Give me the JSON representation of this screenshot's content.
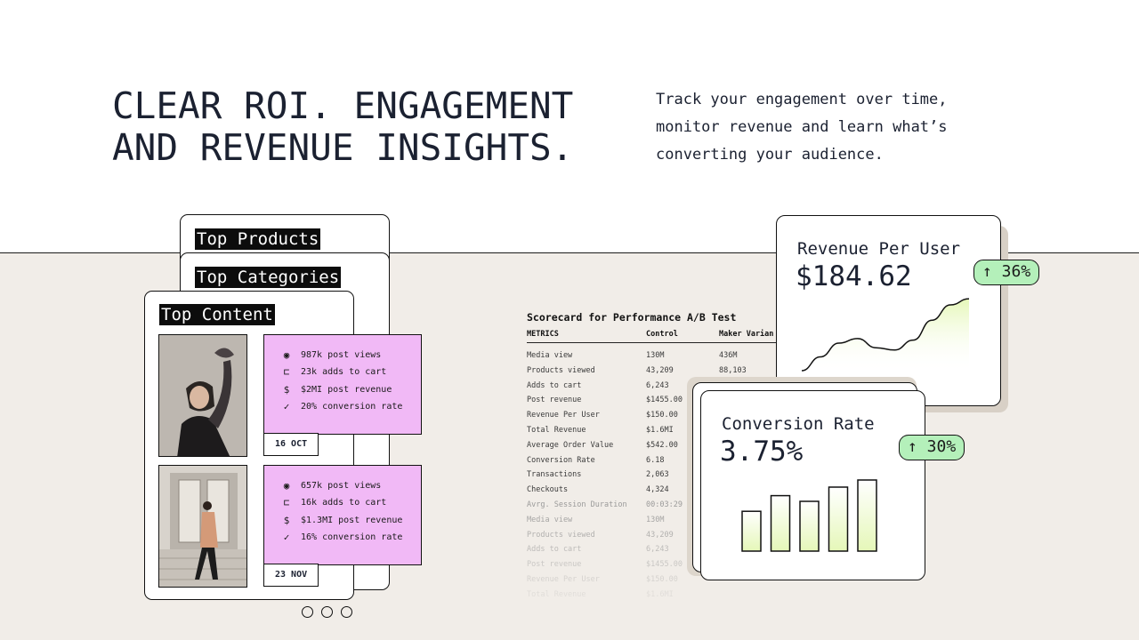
{
  "hero": {
    "headline": [
      "CLEAR ROI. ENGAGEMENT",
      "AND REVENUE INSIGHTS."
    ],
    "subtext": [
      "Track your engagement over time,",
      "monitor revenue and learn what’s",
      "converting your audience."
    ]
  },
  "cards": {
    "top_products": "Top Products",
    "top_categories": "Top Categories",
    "top_content": "Top Content"
  },
  "posts": [
    {
      "stats": [
        {
          "icon": "eye-icon",
          "text": "987k post views"
        },
        {
          "icon": "cart-icon",
          "text": "23k adds to cart"
        },
        {
          "icon": "dollar-icon",
          "text": "$2MI post revenue"
        },
        {
          "icon": "check-icon",
          "text": "20% conversion rate"
        }
      ],
      "date": "16 OCT"
    },
    {
      "stats": [
        {
          "icon": "eye-icon",
          "text": "657k post views"
        },
        {
          "icon": "cart-icon",
          "text": "16k adds to cart"
        },
        {
          "icon": "dollar-icon",
          "text": "$1.3MI post revenue"
        },
        {
          "icon": "check-icon",
          "text": "16% conversion rate"
        }
      ],
      "date": "23 NOV"
    }
  ],
  "scorecard": {
    "title": "Scorecard for Performance A/B Test",
    "headers": [
      "METRICS",
      "Control",
      "Maker Varian"
    ],
    "rows": [
      [
        "Media view",
        "130M",
        "436M"
      ],
      [
        "Products viewed",
        "43,209",
        "88,103"
      ],
      [
        "Adds to cart",
        "6,243",
        ""
      ],
      [
        "Post revenue",
        "$1455.00",
        ""
      ],
      [
        "Revenue Per User",
        "$150.00",
        ""
      ],
      [
        "Total Revenue",
        "$1.6MI",
        ""
      ],
      [
        "Average Order Value",
        "$542.00",
        ""
      ],
      [
        "Conversion Rate",
        "6.18",
        ""
      ],
      [
        "Transactions",
        "2,063",
        ""
      ],
      [
        "Checkouts",
        "4,324",
        ""
      ],
      [
        "Avrg. Session Duration",
        "00:03:29",
        ""
      ],
      [
        "Media view",
        "130M",
        ""
      ],
      [
        "Products viewed",
        "43,209",
        ""
      ],
      [
        "Adds to cart",
        "6,243",
        ""
      ],
      [
        "Post revenue",
        "$1455.00",
        ""
      ],
      [
        "Revenue Per User",
        "$150.00",
        ""
      ],
      [
        "Total Revenue",
        "$1.6MI",
        ""
      ]
    ]
  },
  "revenue_card": {
    "label": "Revenue Per User",
    "value": "$184.62",
    "badge": "↑ 36%",
    "trend_values": [
      0.0,
      0.18,
      0.36,
      0.42,
      0.3,
      0.27,
      0.4,
      0.66,
      0.86,
      0.94
    ]
  },
  "conversion_card": {
    "label": "Conversion Rate",
    "value": "3.75%",
    "badge": "↑ 30%",
    "bar_values": [
      0.56,
      0.78,
      0.7,
      0.9,
      1.0
    ]
  },
  "carousel": {
    "dots": 3
  },
  "colors": {
    "text": "#1b2131",
    "stats_bg": "#f1b9f6",
    "badge_bg": "#b4f0ba",
    "chart_fill": "#e5f7b8",
    "lower_bg": "#f1ede8"
  }
}
